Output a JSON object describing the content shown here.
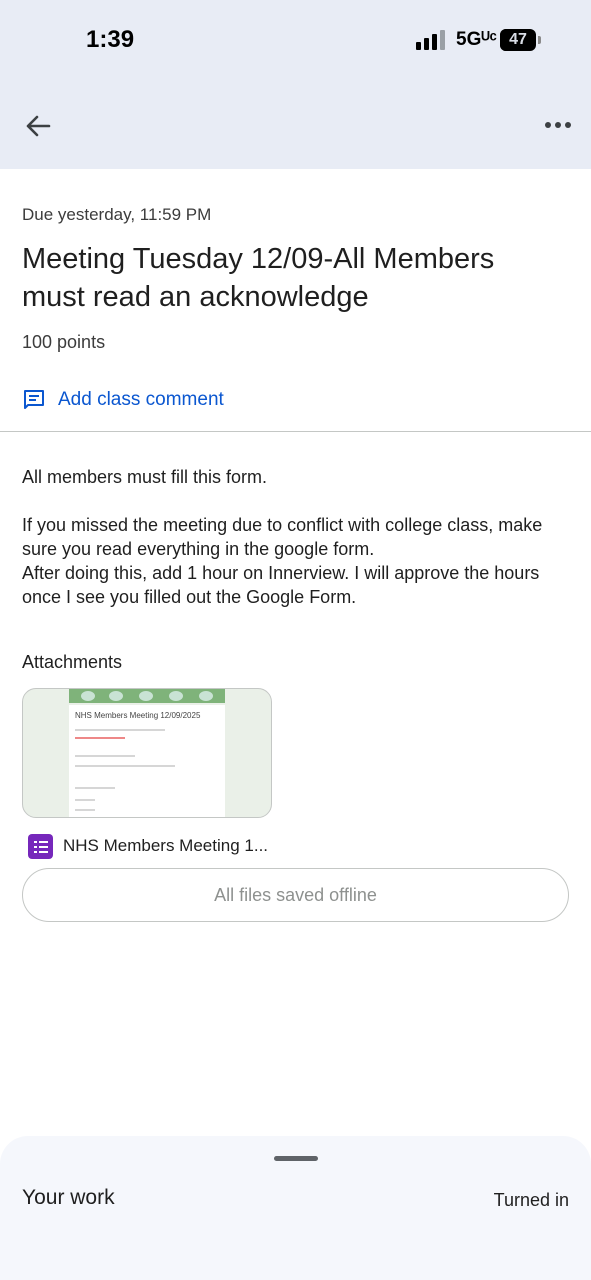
{
  "status_bar": {
    "time": "1:39",
    "network": "5Gᵁᶜ",
    "battery": "47",
    "battery_level_percent": 47
  },
  "app_bar": {
    "back_icon": "arrow-left-icon",
    "more_icon": "more-horizontal-icon"
  },
  "assignment": {
    "due": "Due yesterday, 11:59 PM",
    "title": "Meeting Tuesday 12/09-All Members must read an acknowledge",
    "points": "100 points",
    "comment_label": "Add class comment",
    "comment_icon": "comment-icon",
    "accent_color": "#0b57d0"
  },
  "description": {
    "line1": "All members must fill this form.",
    "line2": "If you missed the meeting due to conflict with college class, make sure you read everything in the google form.",
    "line3": "After doing this, add 1 hour on Innerview. I will approve the hours once I see you filled out the Google Form."
  },
  "attachments": {
    "heading": "Attachments",
    "preview_title": "NHS Members Meeting 12/09/2025",
    "file_name": "NHS Members Meeting 1...",
    "file_icon": "google-forms-icon",
    "file_icon_color": "#7627bb",
    "offline_label": "All files saved offline"
  },
  "your_work": {
    "label": "Your work",
    "status": "Turned in"
  }
}
